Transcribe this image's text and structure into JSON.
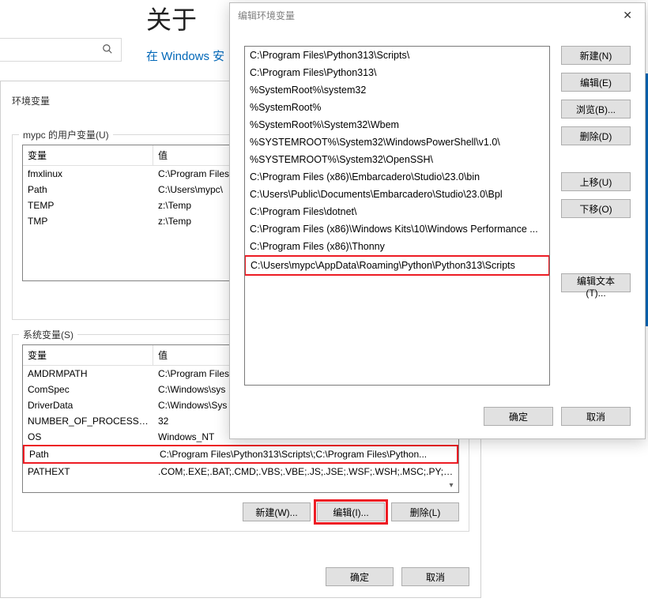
{
  "bg": {
    "about": "关于",
    "windows_link": "在 Windows 安"
  },
  "env_dialog": {
    "title": "环境变量",
    "user_group": "mypc 的用户变量(U)",
    "sys_group": "系统变量(S)",
    "col_name": "变量",
    "col_value": "值",
    "user_vars": [
      {
        "name": "fmxlinux",
        "value": "C:\\Program Files"
      },
      {
        "name": "Path",
        "value": "C:\\Users\\mypc\\"
      },
      {
        "name": "TEMP",
        "value": "z:\\Temp"
      },
      {
        "name": "TMP",
        "value": "z:\\Temp"
      }
    ],
    "sys_vars": [
      {
        "name": "AMDRMPATH",
        "value": "C:\\Program Files"
      },
      {
        "name": "ComSpec",
        "value": "C:\\Windows\\sys"
      },
      {
        "name": "DriverData",
        "value": "C:\\Windows\\Sys"
      },
      {
        "name": "NUMBER_OF_PROCESSORS",
        "value": "32"
      },
      {
        "name": "OS",
        "value": "Windows_NT"
      },
      {
        "name": "Path",
        "value": "C:\\Program Files\\Python313\\Scripts\\;C:\\Program Files\\Python...",
        "hl": true
      },
      {
        "name": "PATHEXT",
        "value": ".COM;.EXE;.BAT;.CMD;.VBS;.VBE;.JS;.JSE;.WSF;.WSH;.MSC;.PY;.P..."
      }
    ],
    "buttons": {
      "new": "新建(W)...",
      "edit": "编辑(I)...",
      "delete": "删除(L)",
      "ok": "确定",
      "cancel": "取消"
    }
  },
  "edit_dialog": {
    "title": "编辑环境变量",
    "items": [
      "C:\\Program Files\\Python313\\Scripts\\",
      "C:\\Program Files\\Python313\\",
      "%SystemRoot%\\system32",
      "%SystemRoot%",
      "%SystemRoot%\\System32\\Wbem",
      "%SYSTEMROOT%\\System32\\WindowsPowerShell\\v1.0\\",
      "%SYSTEMROOT%\\System32\\OpenSSH\\",
      "C:\\Program Files (x86)\\Embarcadero\\Studio\\23.0\\bin",
      "C:\\Users\\Public\\Documents\\Embarcadero\\Studio\\23.0\\Bpl",
      "C:\\Program Files\\dotnet\\",
      "C:\\Program Files (x86)\\Windows Kits\\10\\Windows Performance ...",
      "C:\\Program Files (x86)\\Thonny"
    ],
    "hl_item": "C:\\Users\\mypc\\AppData\\Roaming\\Python\\Python313\\Scripts",
    "buttons": {
      "new": "新建(N)",
      "edit": "编辑(E)",
      "browse": "浏览(B)...",
      "delete": "删除(D)",
      "up": "上移(U)",
      "down": "下移(O)",
      "edit_text": "编辑文本(T)...",
      "ok": "确定",
      "cancel": "取消"
    }
  }
}
